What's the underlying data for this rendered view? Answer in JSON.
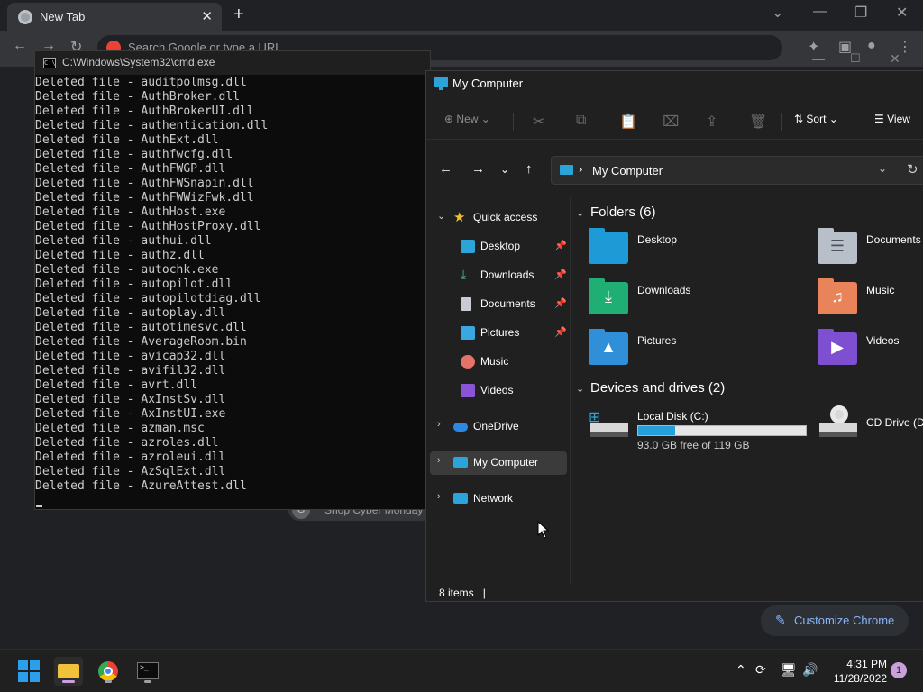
{
  "chrome": {
    "tab_title": "New Tab",
    "omnibox_placeholder": "Search Google or type a URL",
    "shortcut_label": "Shop Cyber Monday",
    "shortcut_letter": "G",
    "customize_label": "Customize Chrome"
  },
  "cmd": {
    "title": "C:\\Windows\\System32\\cmd.exe",
    "lines": [
      "Deleted file - auditpolmsg.dll",
      "Deleted file - AuthBroker.dll",
      "Deleted file - AuthBrokerUI.dll",
      "Deleted file - authentication.dll",
      "Deleted file - AuthExt.dll",
      "Deleted file - authfwcfg.dll",
      "Deleted file - AuthFWGP.dll",
      "Deleted file - AuthFWSnapin.dll",
      "Deleted file - AuthFWWizFwk.dll",
      "Deleted file - AuthHost.exe",
      "Deleted file - AuthHostProxy.dll",
      "Deleted file - authui.dll",
      "Deleted file - authz.dll",
      "Deleted file - autochk.exe",
      "Deleted file - autopilot.dll",
      "Deleted file - autopilotdiag.dll",
      "Deleted file - autoplay.dll",
      "Deleted file - autotimesvc.dll",
      "Deleted file - AverageRoom.bin",
      "Deleted file - avicap32.dll",
      "Deleted file - avifil32.dll",
      "Deleted file - avrt.dll",
      "Deleted file - AxInstSv.dll",
      "Deleted file - AxInstUI.exe",
      "Deleted file - azman.msc",
      "Deleted file - azroles.dll",
      "Deleted file - azroleui.dll",
      "Deleted file - AzSqlExt.dll",
      "Deleted file - AzureAttest.dll"
    ]
  },
  "explorer": {
    "title": "My Computer",
    "toolbar": {
      "new_label": "New",
      "sort_label": "Sort",
      "view_label": "View"
    },
    "address": "My Computer",
    "nav": {
      "quick_access": "Quick access",
      "items": [
        {
          "label": "Desktop",
          "pinned": true
        },
        {
          "label": "Downloads",
          "pinned": true
        },
        {
          "label": "Documents",
          "pinned": true
        },
        {
          "label": "Pictures",
          "pinned": true
        },
        {
          "label": "Music",
          "pinned": false
        },
        {
          "label": "Videos",
          "pinned": false
        }
      ],
      "onedrive": "OneDrive",
      "my_computer": "My Computer",
      "network": "Network"
    },
    "folders_header": "Folders (6)",
    "folders": [
      "Desktop",
      "Documents",
      "Downloads",
      "Music",
      "Pictures",
      "Videos"
    ],
    "drives_header": "Devices and drives (2)",
    "drives": [
      {
        "label": "Local Disk (C:)",
        "free_text": "93.0 GB free of 119 GB",
        "used_fraction": 0.22
      },
      {
        "label": "CD Drive (D:)"
      }
    ],
    "status": "8 items"
  },
  "taskbar": {
    "time": "4:31 PM",
    "date": "11/28/2022",
    "notification_count": "1"
  },
  "colors": {
    "accent": "#26a0da",
    "cmd_text": "#cccccc",
    "chrome_link": "#8ab4f8"
  }
}
